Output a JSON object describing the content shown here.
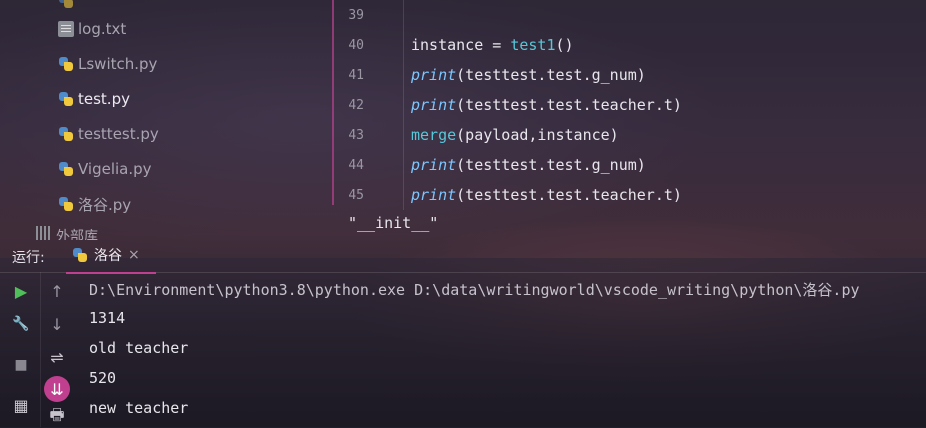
{
  "project_tree": {
    "items": [
      {
        "name": "log.txt",
        "type": "txt"
      },
      {
        "name": "Lswitch.py",
        "type": "py"
      },
      {
        "name": "test.py",
        "type": "py"
      },
      {
        "name": "testtest.py",
        "type": "py"
      },
      {
        "name": "Vigelia.py",
        "type": "py"
      },
      {
        "name": "洛谷.py",
        "type": "py"
      }
    ],
    "partial_top": "log.txt",
    "partial_bottom": "外部库"
  },
  "editor": {
    "lines": [
      {
        "num": "39",
        "tokens": []
      },
      {
        "num": "40",
        "tokens": [
          {
            "t": "instance = ",
            "c": "plain"
          },
          {
            "t": "test1",
            "c": "fn"
          },
          {
            "t": "()",
            "c": "punc"
          }
        ]
      },
      {
        "num": "41",
        "tokens": [
          {
            "t": "print",
            "c": "builtin"
          },
          {
            "t": "(testtest.test.g_num)",
            "c": "plain"
          }
        ]
      },
      {
        "num": "42",
        "tokens": [
          {
            "t": "print",
            "c": "builtin"
          },
          {
            "t": "(testtest.test.teacher.t)",
            "c": "plain"
          }
        ]
      },
      {
        "num": "43",
        "tokens": [
          {
            "t": "merge",
            "c": "fn"
          },
          {
            "t": "(payload,instance)",
            "c": "plain"
          }
        ]
      },
      {
        "num": "44",
        "tokens": [
          {
            "t": "print",
            "c": "builtin"
          },
          {
            "t": "(testtest.test.g_num)",
            "c": "plain"
          }
        ]
      },
      {
        "num": "45",
        "tokens": [
          {
            "t": "print",
            "c": "builtin"
          },
          {
            "t": "(testtest.test.teacher.t)",
            "c": "plain"
          }
        ]
      }
    ],
    "breadcrumb": "\"__init__\""
  },
  "run_window": {
    "label": "运行:",
    "tab_name": "洛谷",
    "tab_close": "×"
  },
  "toolbar": {
    "run": "▶",
    "up": "↑",
    "wrench": "🔧",
    "down": "↓",
    "stop": "■",
    "wrap": "⇌",
    "scroll_end": "⇊",
    "layout": "▦",
    "print": "🖶"
  },
  "console": {
    "lines": [
      "D:\\Environment\\python3.8\\python.exe D:\\data\\writingworld\\vscode_writing\\python\\洛谷.py",
      "1314",
      "old teacher",
      "520",
      "new teacher"
    ]
  },
  "colors": {
    "accent": "#c04090",
    "fn": "#56c8d8",
    "builtin": "#7cc7ff"
  }
}
